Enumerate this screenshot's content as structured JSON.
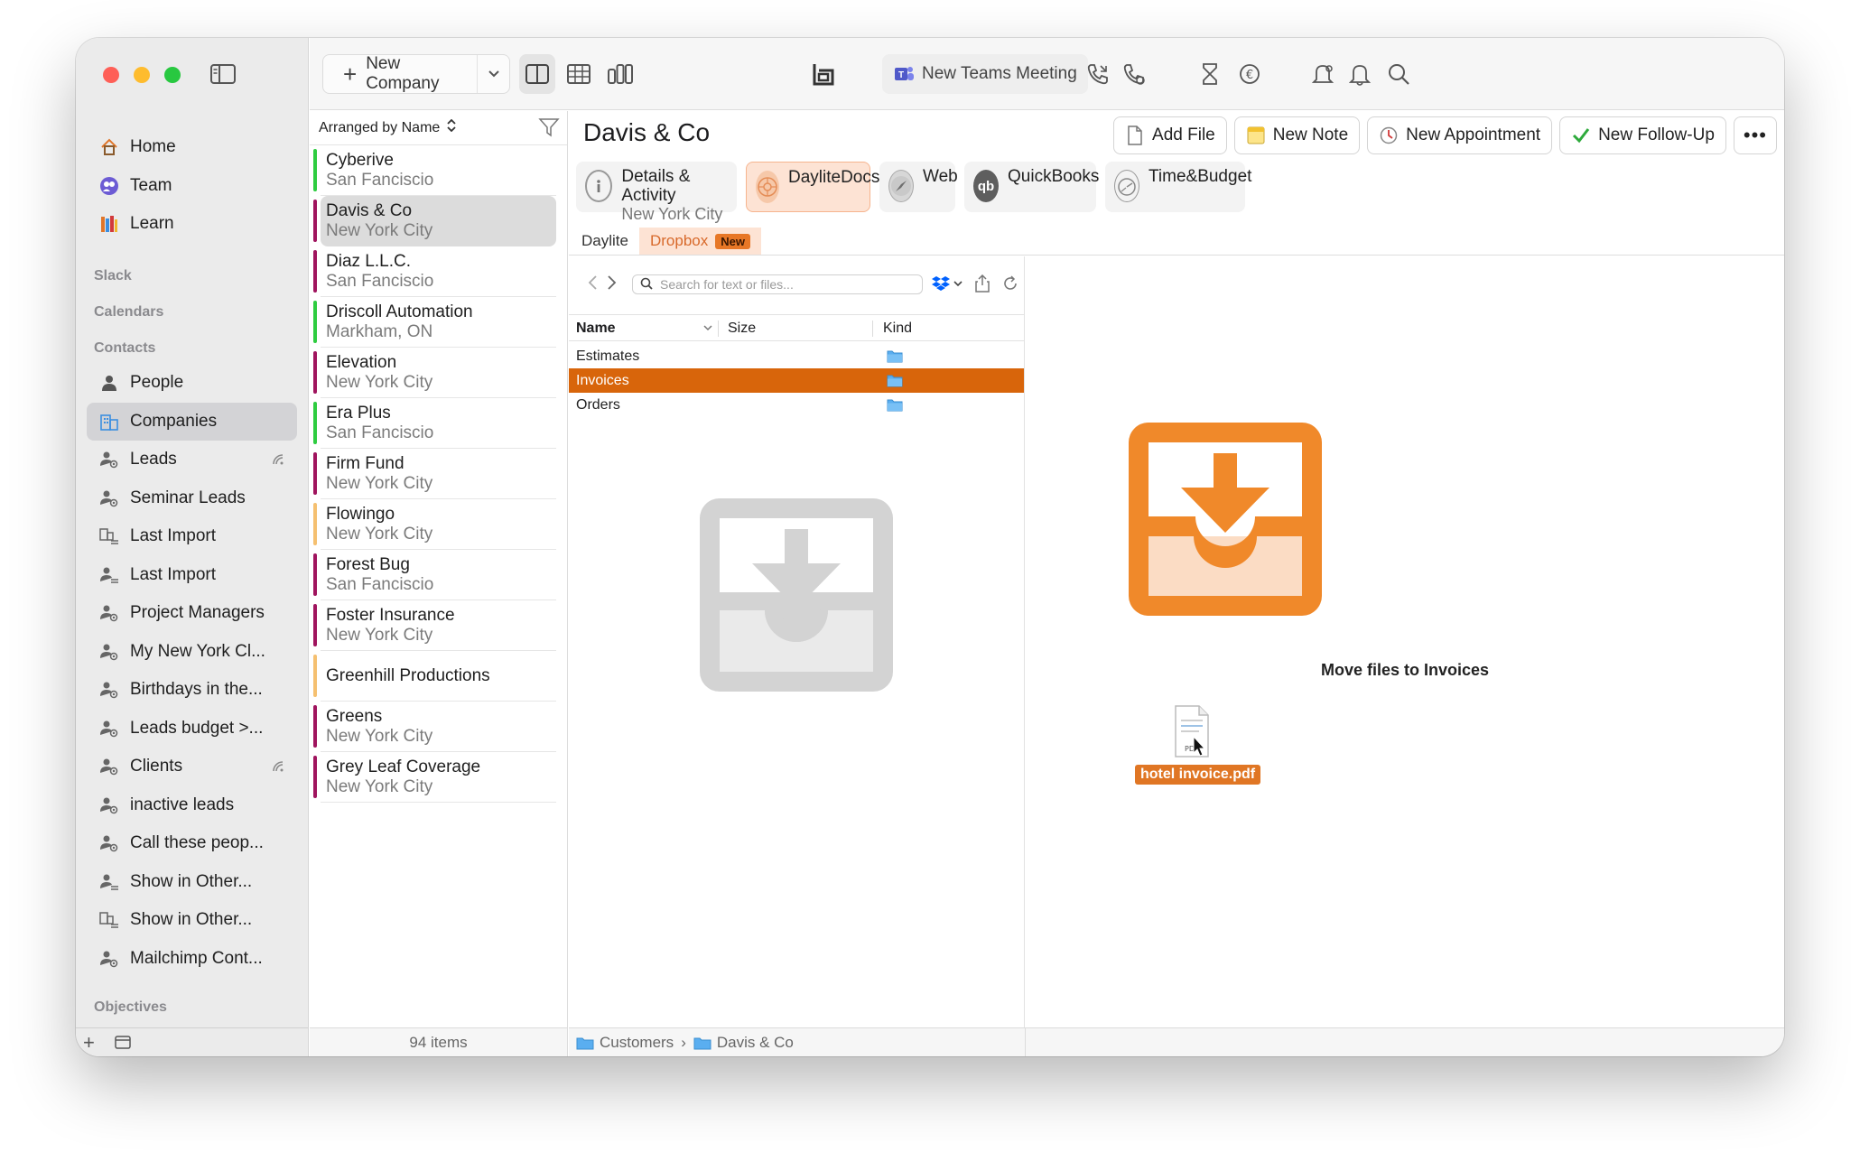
{
  "toolbar": {
    "new_company_label": "New Company",
    "teams_label": "New Teams Meeting"
  },
  "sidebar": {
    "nav": [
      {
        "label": "Home",
        "icon": "house-icon"
      },
      {
        "label": "Team",
        "icon": "team-icon"
      },
      {
        "label": "Learn",
        "icon": "books-icon"
      }
    ],
    "sections": {
      "slack": "Slack",
      "calendars": "Calendars",
      "contacts": "Contacts",
      "objectives": "Objectives"
    },
    "contacts": [
      {
        "label": "People",
        "icon": "person-icon"
      },
      {
        "label": "Companies",
        "icon": "building-icon",
        "selected": true
      },
      {
        "label": "Leads",
        "icon": "smart-list-icon",
        "extra": "sync-icon"
      },
      {
        "label": "Seminar Leads",
        "icon": "smart-list-icon"
      },
      {
        "label": "Last Import",
        "icon": "building-list-icon"
      },
      {
        "label": "Last Import",
        "icon": "person-list-icon"
      },
      {
        "label": "Project Managers",
        "icon": "smart-list-icon"
      },
      {
        "label": "My New York Cl...",
        "icon": "smart-list-icon"
      },
      {
        "label": "Birthdays in the...",
        "icon": "smart-list-icon"
      },
      {
        "label": "Leads budget >...",
        "icon": "smart-list-icon"
      },
      {
        "label": "Clients",
        "icon": "smart-list-icon",
        "extra": "sync-icon"
      },
      {
        "label": "inactive leads",
        "icon": "smart-list-icon"
      },
      {
        "label": "Call these peop...",
        "icon": "smart-list-icon"
      },
      {
        "label": "Show in Other...",
        "icon": "person-list-icon"
      },
      {
        "label": "Show in Other...",
        "icon": "building-list-icon"
      },
      {
        "label": "Mailchimp Cont...",
        "icon": "smart-list-icon"
      }
    ]
  },
  "list": {
    "arranged_label": "Arranged by Name",
    "count_label": "94 items",
    "rows": [
      {
        "name": "Cyberive",
        "city": "San Fanciscio",
        "color": "#2ecc40"
      },
      {
        "name": "Davis & Co",
        "city": "New York City",
        "color": "#a0145e",
        "selected": true
      },
      {
        "name": "Diaz L.L.C.",
        "city": "San Fanciscio",
        "color": "#a0145e"
      },
      {
        "name": "Driscoll Automation",
        "city": "Markham, ON",
        "color": "#2ecc40"
      },
      {
        "name": "Elevation",
        "city": "New York City",
        "color": "#a0145e"
      },
      {
        "name": "Era Plus",
        "city": "San Fanciscio",
        "color": "#2ecc40"
      },
      {
        "name": "Firm Fund",
        "city": "New York City",
        "color": "#a0145e"
      },
      {
        "name": "Flowingo",
        "city": "New York City",
        "color": "#f5c070"
      },
      {
        "name": "Forest Bug",
        "city": "San Fanciscio",
        "color": "#a0145e"
      },
      {
        "name": "Foster Insurance",
        "city": "New York City",
        "color": "#a0145e"
      },
      {
        "name": "Greenhill Productions",
        "city": "",
        "color": "#f5c070"
      },
      {
        "name": "Greens",
        "city": "New York City",
        "color": "#a0145e"
      },
      {
        "name": "Grey Leaf Coverage",
        "city": "New York City",
        "color": "#a0145e"
      }
    ]
  },
  "detail": {
    "title": "Davis & Co",
    "actions": {
      "add_file": "Add File",
      "new_note": "New Note",
      "new_appointment": "New Appointment",
      "new_followup": "New Follow-Up"
    },
    "tabs": {
      "details_title": "Details & Activity",
      "details_sub": "New York City",
      "daylitedocs": "DayliteDocs",
      "web": "Web",
      "quickbooks": "QuickBooks",
      "timebudget": "Time&Budget"
    },
    "subtabs": {
      "daylite": "Daylite",
      "dropbox": "Dropbox",
      "badge": "New"
    }
  },
  "browser": {
    "search_placeholder": "Search for text or files...",
    "columns": {
      "name": "Name",
      "size": "Size",
      "kind": "Kind"
    },
    "files": [
      {
        "name": "Estimates"
      },
      {
        "name": "Invoices",
        "selected": true
      },
      {
        "name": "Orders"
      }
    ],
    "path": [
      "Customers",
      "Davis & Co"
    ]
  },
  "drop": {
    "move_label": "Move files to Invoices",
    "file_label": "hotel invoice.pdf"
  },
  "colors": {
    "accent_orange": "#d8650b",
    "tray_orange": "#f0892a",
    "selection_gray": "#d3d3d6"
  }
}
